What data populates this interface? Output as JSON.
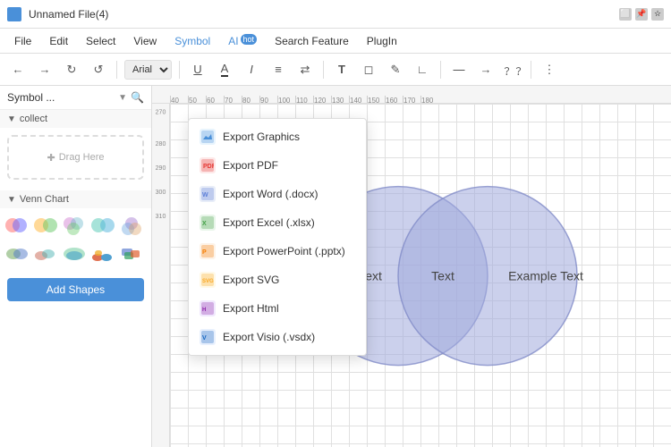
{
  "titleBar": {
    "title": "Unnamed File(4)",
    "controls": [
      "minimize",
      "restore",
      "bookmark",
      "star"
    ]
  },
  "menuBar": {
    "items": [
      {
        "label": "File",
        "id": "file"
      },
      {
        "label": "Edit",
        "id": "edit"
      },
      {
        "label": "Select",
        "id": "select"
      },
      {
        "label": "View",
        "id": "view"
      },
      {
        "label": "Symbol",
        "id": "symbol",
        "highlight": true
      },
      {
        "label": "AI",
        "id": "ai",
        "badge": "hot"
      },
      {
        "label": "Search Feature",
        "id": "search"
      },
      {
        "label": "PlugIn",
        "id": "plugin"
      }
    ]
  },
  "sidebar": {
    "title": "Symbol ...",
    "sections": [
      {
        "label": "collect",
        "id": "collect"
      },
      {
        "label": "Venn Chart",
        "id": "venn"
      }
    ],
    "dragArea": "Drag Here",
    "addShapesBtn": "Add Shapes"
  },
  "dropdown": {
    "items": [
      {
        "label": "Export Graphics",
        "icon": "graphics",
        "color": "#4a90d9"
      },
      {
        "label": "Export PDF",
        "icon": "pdf",
        "color": "#e53935"
      },
      {
        "label": "Export Word (.docx)",
        "icon": "word",
        "color": "#5c7fd8"
      },
      {
        "label": "Export Excel (.xlsx)",
        "icon": "excel",
        "color": "#43a047"
      },
      {
        "label": "Export PowerPoint (.pptx)",
        "icon": "ppt",
        "color": "#f57c00"
      },
      {
        "label": "Export SVG",
        "icon": "svg",
        "color": "#f9a825"
      },
      {
        "label": "Export Html",
        "icon": "html",
        "color": "#8e24aa"
      },
      {
        "label": "Export Visio (.vsdx)",
        "icon": "visio",
        "color": "#1565c0"
      }
    ]
  },
  "canvas": {
    "venn": {
      "leftText": "Example Text",
      "centerText": "Text",
      "rightText": "Example Text"
    },
    "rulerMarks": [
      "40",
      "50",
      "60",
      "70",
      "80",
      "90",
      "100",
      "110",
      "120",
      "130",
      "140",
      "150",
      "160",
      "170",
      "180"
    ]
  },
  "toolbar": {
    "font": "Arial",
    "buttons": [
      "←",
      "→",
      "↺",
      "↻"
    ]
  }
}
